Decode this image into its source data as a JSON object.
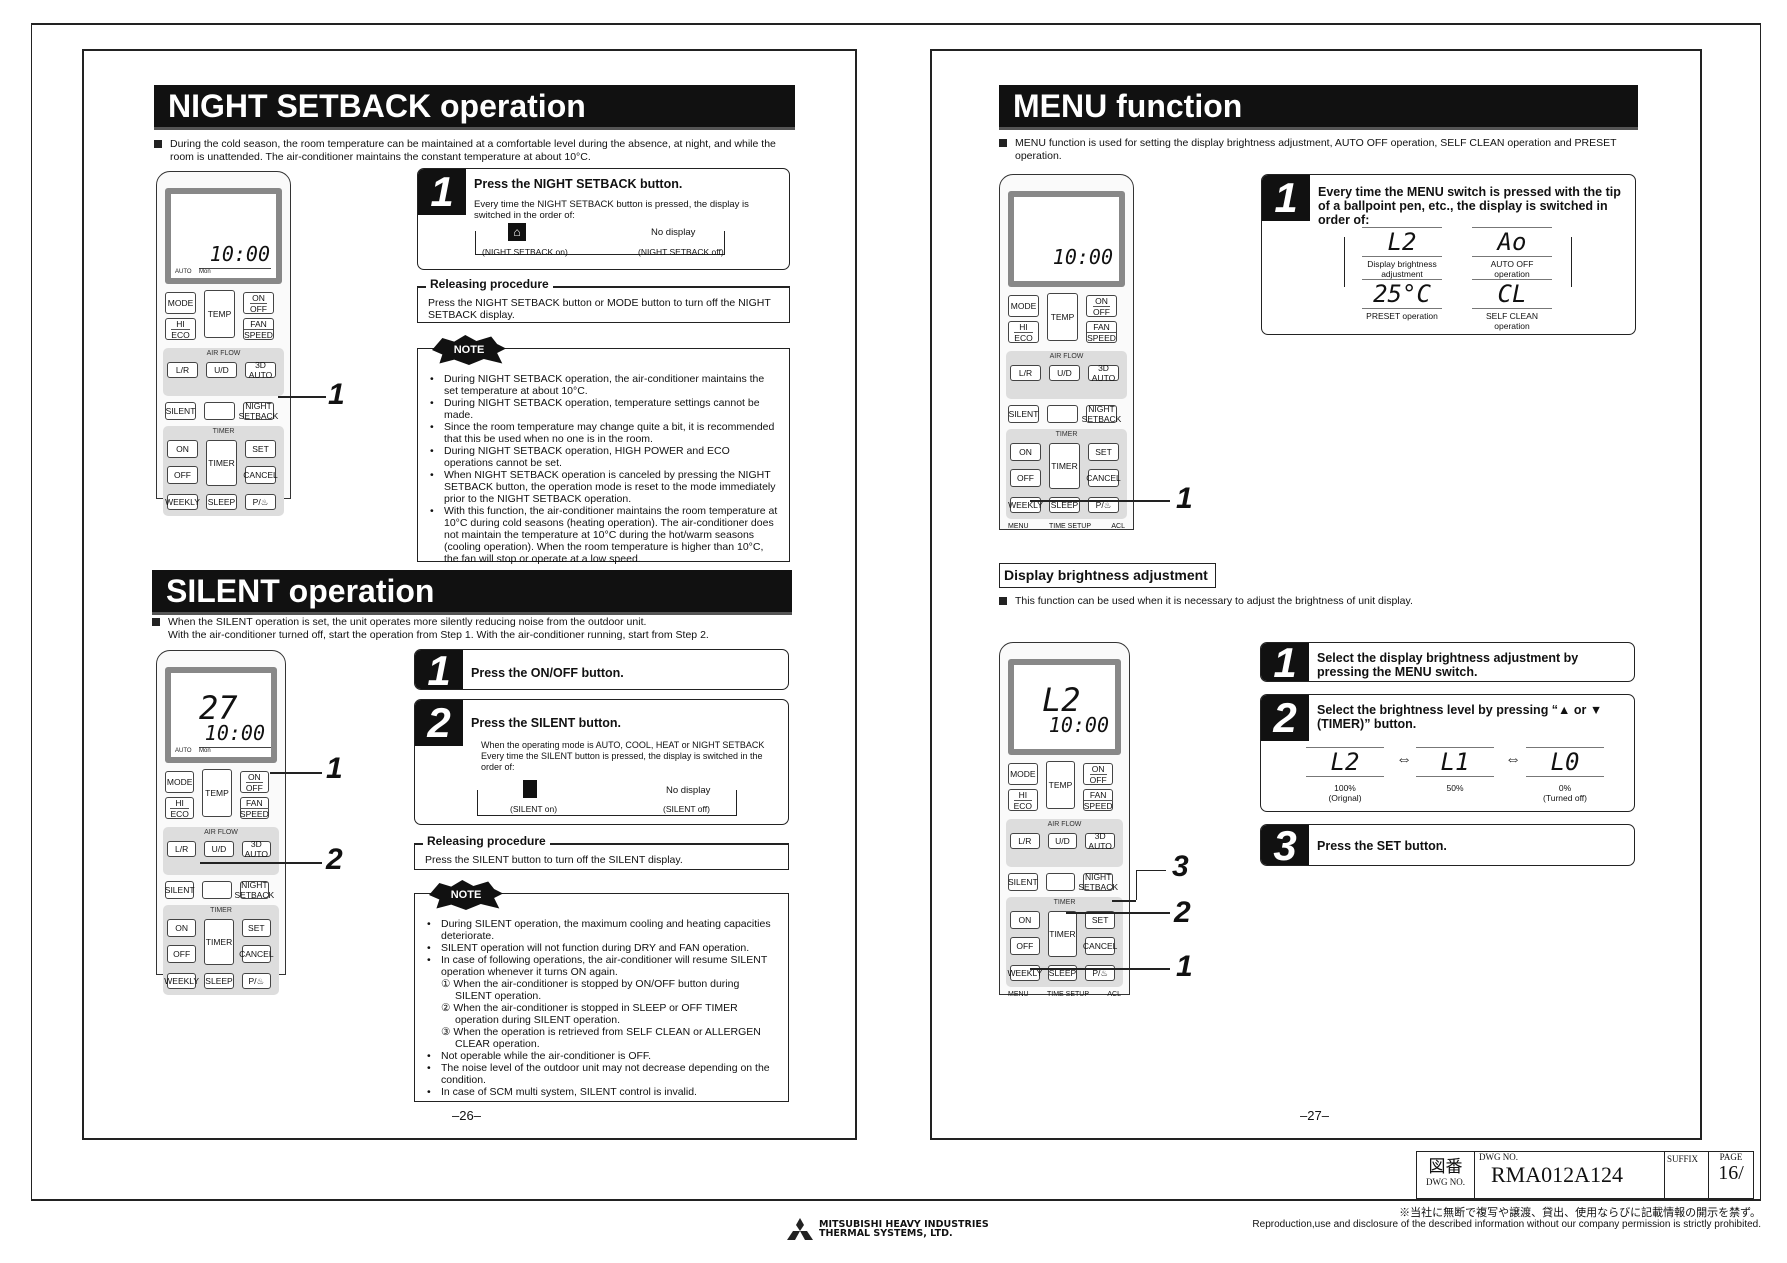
{
  "left_page": {
    "night": {
      "title": "NIGHT SETBACK operation",
      "intro": "During the cold season, the room temperature can be maintained at a comfortable level during the absence, at night, and while the room is unattended. The air-conditioner maintains the constant temperature at about 10°C.",
      "step1": {
        "num": "1",
        "title": "Press the NIGHT SETBACK button.",
        "text": "Every time the NIGHT SETBACK button is pressed, the display is switched in the order of:",
        "on": "(NIGHT SETBACK on)",
        "no_display": "No display",
        "off": "(NIGHT SETBACK off)"
      },
      "releasing": {
        "title": "Releasing procedure",
        "text": "Press the NIGHT SETBACK button or MODE button to turn off the NIGHT SETBACK display."
      },
      "note_label": "NOTE",
      "notes": [
        "During NIGHT SETBACK operation, the air-conditioner maintains the set temperature at about 10°C.",
        "During NIGHT SETBACK operation, temperature settings cannot be made.",
        "Since the room temperature may change quite a bit, it is recommended that this be used when no one is in the room.",
        "During NIGHT SETBACK operation, HIGH POWER and ECO operations cannot be set.",
        "When NIGHT SETBACK operation is canceled by pressing the NIGHT SETBACK button, the operation mode is reset to the mode immediately prior to the NIGHT SETBACK operation.",
        "With this function, the air-conditioner maintains the room temperature at 10°C during cold seasons (heating operation). The air-conditioner does not maintain the temperature at 10°C during the hot/warm seasons (cooling operation). When the room temperature is higher than 10°C, the fan will stop or operate at a low speed."
      ],
      "callouts": [
        "1"
      ]
    },
    "silent": {
      "title": "SILENT operation",
      "intro1": "When the SILENT operation is set, the unit operates more silently reducing noise from the outdoor unit.",
      "intro2": "With the air-conditioner turned off, start the operation from Step 1. With the air-conditioner running, start from Step 2.",
      "step1": {
        "num": "1",
        "title": "Press the ON/OFF button."
      },
      "step2": {
        "num": "2",
        "title": "Press the SILENT button.",
        "text": "When the operating mode is AUTO, COOL, HEAT or NIGHT SETBACK Every time the SILENT button is pressed, the display is switched in the order of:",
        "on": "(SILENT on)",
        "no_display": "No display",
        "off": "(SILENT off)"
      },
      "releasing": {
        "title": "Releasing procedure",
        "text": "Press the SILENT button to turn off the SILENT display."
      },
      "note_label": "NOTE",
      "notes": [
        "During SILENT operation, the maximum cooling and heating capacities deteriorate.",
        "SILENT operation will not function during DRY and FAN operation.",
        "In case of following operations, the air-conditioner will resume SILENT operation whenever it turns ON again."
      ],
      "subnotes": [
        "① When the air-conditioner is stopped by ON/OFF button during SILENT operation.",
        "② When the air-conditioner is stopped in SLEEP or OFF TIMER operation during SILENT operation.",
        "③ When the operation is retrieved from SELF CLEAN or ALLERGEN CLEAR operation."
      ],
      "notes2": [
        "Not operable while the air-conditioner is OFF.",
        "The noise level of the outdoor unit may not decrease depending on the condition.",
        "In case of SCM multi system, SILENT control is invalid."
      ],
      "callouts": [
        "1",
        "2"
      ],
      "lcd_temp": "27"
    },
    "page_number": "–26–"
  },
  "right_page": {
    "menu": {
      "title": "MENU function",
      "intro": "MENU function is used for setting the display brightness adjustment, AUTO OFF operation, SELF CLEAN operation and PRESET operation.",
      "step1": {
        "num": "1",
        "title": "Every time the MENU switch is pressed with the tip of a ballpoint pen, etc., the display is switched in order of:"
      },
      "cycle": [
        {
          "code": "L2",
          "label": "Display brightness adjustment"
        },
        {
          "code": "Ao",
          "label": "AUTO OFF operation"
        },
        {
          "code": "CL",
          "label": "SELF CLEAN operation"
        },
        {
          "code": "25°C",
          "label": "PRESET operation"
        }
      ],
      "callouts": [
        "1"
      ]
    },
    "brightness": {
      "heading": "Display brightness adjustment",
      "intro": "This function can be used when it is necessary to adjust the brightness of unit display.",
      "step1": {
        "num": "1",
        "title": "Select the display brightness adjustment by pressing the MENU switch."
      },
      "step2": {
        "num": "2",
        "title": "Select the brightness level by pressing “▲ or ▼ (TIMER)” button."
      },
      "levels": [
        {
          "code": "L2",
          "value": "100%",
          "note": "(Orignal)"
        },
        {
          "code": "L1",
          "value": "50%",
          "note": ""
        },
        {
          "code": "L0",
          "value": "0%",
          "note": "(Turned off)"
        }
      ],
      "arrow": "⇔",
      "step3": {
        "num": "3",
        "title": "Press the SET button."
      },
      "callouts": [
        "3",
        "2",
        "1"
      ],
      "lcd_code": "L2"
    },
    "page_number": "–27–"
  },
  "remote": {
    "time": "10:00",
    "mode": "MODE",
    "temp": "TEMP",
    "on": "ON",
    "off": "OFF",
    "hi": "HI",
    "eco": "ECO",
    "fan": "FAN",
    "speed": "SPEED",
    "airflow": "AIR FLOW",
    "lr": "L/R",
    "ud": "U/D",
    "auto3d": "3D AUTO",
    "silent": "SILENT",
    "night": "NIGHT SETBACK",
    "timer": "TIMER",
    "on_timer": "ON",
    "off_timer": "OFF",
    "set": "SET",
    "cancel": "CANCEL",
    "weekly": "WEEKLY",
    "sleep": "SLEEP",
    "p": "P/♨",
    "menu": "MENU",
    "time_setup": "TIME SETUP",
    "acl": "ACL",
    "auto_label": "AUTO",
    "day": "Mon"
  },
  "title_block": {
    "jp_label": "図番",
    "dwg_label_small": "DWG NO.",
    "dwg_label": "DWG NO.",
    "dwg_no": "RMA012A124",
    "suffix_label": "SUFFIX",
    "suffix": "",
    "page_label": "PAGE",
    "page": "16/"
  },
  "footer": {
    "jp_notice": "※当社に無断で複写や譲渡、貸出、使用ならびに記載情報の開示を禁ず。",
    "en_notice": "Reproduction,use and disclosure of the described information without our company permission is strictly prohibited.",
    "company_line1": "MITSUBISHI HEAVY INDUSTRIES",
    "company_line2": "THERMAL SYSTEMS, LTD."
  }
}
